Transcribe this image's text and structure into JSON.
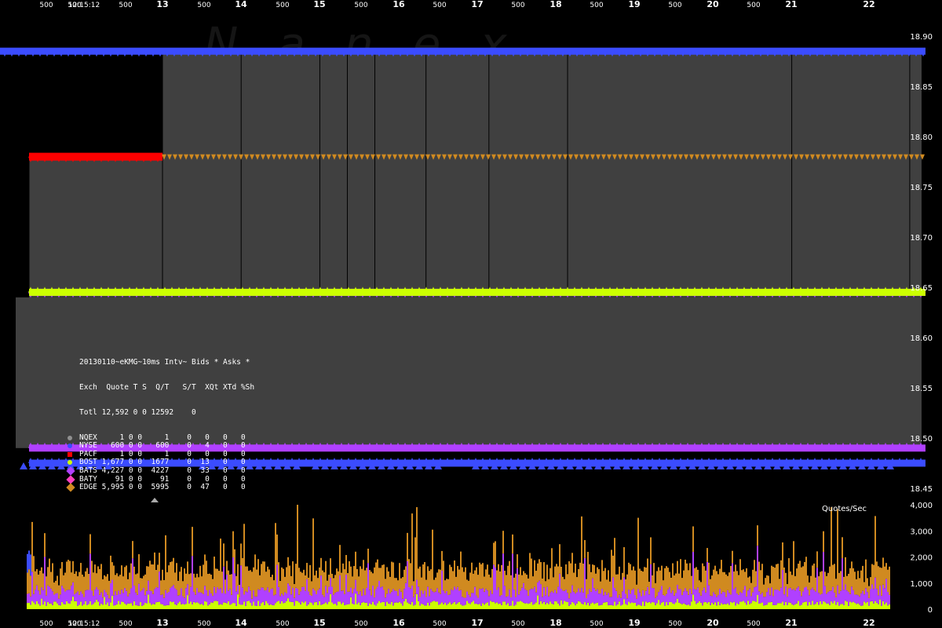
{
  "watermark": "Nanex",
  "x_axis": {
    "labels_top": [
      "500",
      "12:15:12",
      "500",
      "13",
      "500",
      "14",
      "500",
      "15",
      "500",
      "16",
      "500",
      "17",
      "500",
      "18",
      "500",
      "19",
      "500",
      "20",
      "500",
      "21",
      "500",
      "22"
    ],
    "labels_bottom": [
      "500",
      "12:15:12",
      "500",
      "13",
      "500",
      "14",
      "500",
      "15",
      "500",
      "16",
      "500",
      "17",
      "500",
      "18",
      "500",
      "19",
      "500",
      "20",
      "500",
      "21",
      "500",
      "22"
    ]
  },
  "price_axis": [
    "18.90",
    "18.85",
    "18.80",
    "18.75",
    "18.70",
    "18.65",
    "18.60",
    "18.55",
    "18.50",
    "18.45"
  ],
  "rate_axis": [
    "4,000",
    "3,000",
    "2,000",
    "1,000",
    "0"
  ],
  "rate_axis_title": "Quotes/Sec",
  "legend": {
    "title": "20130110~eKMG~10ms Intv~ Bids * Asks *",
    "header": "Exch  Quote T S  Q/T   S/T  XQt XTd %Sh",
    "total": "Totl 12,592 0 0 12592    0",
    "rows": [
      {
        "exch": "NQEX",
        "text": "NQEX     1 0 0     1    0   0   0   0",
        "color": "#909090",
        "shape": "circle"
      },
      {
        "exch": "NYSE",
        "text": "NYSE   600 0 0   600    0   4   0   0",
        "color": "#3b4cff",
        "shape": "circle"
      },
      {
        "exch": "PACF",
        "text": "PACF     1 0 0     1    0   0   0   0",
        "color": "#ff0000",
        "shape": "square"
      },
      {
        "exch": "BOST",
        "text": "BOST 1,677 0 0  1677    0  13   0   0",
        "color": "#ccff00",
        "shape": "circle"
      },
      {
        "exch": "BATS",
        "text": "BATS 4,227 0 0  4227    0  33   0   0",
        "color": "#b040ff",
        "shape": "diamond"
      },
      {
        "exch": "BATY",
        "text": "BATY    91 0 0    91    0   0   0   0",
        "color": "#ff40c0",
        "shape": "diamond"
      },
      {
        "exch": "EDGE",
        "text": "EDGE 5,995 0 0  5995    0  47   0   0",
        "color": "#d08a20",
        "shape": "diamond"
      }
    ]
  },
  "chart_data": [
    {
      "type": "line",
      "title": "20130110~eKMG~10ms Intv~ Bids * Asks *",
      "ylim": [
        18.45,
        18.9
      ],
      "x_start_label": "12:15:12",
      "series": [
        {
          "name": "NYSE",
          "role": "ask",
          "color": "#3b4cff",
          "x": [
            0,
            13.0,
            22.7
          ],
          "y": [
            18.88,
            18.885,
            18.885
          ]
        },
        {
          "name": "PACF",
          "role": "ask",
          "color": "#ff0000",
          "x": [
            12.0,
            13.0
          ],
          "y": [
            18.78,
            18.78
          ]
        },
        {
          "name": "EDGE",
          "role": "ask",
          "color": "#d08a20",
          "x": [
            13.0,
            22.7
          ],
          "y": [
            18.78,
            18.78
          ]
        },
        {
          "name": "BATS",
          "role": "bid",
          "color": "#b040ff",
          "x": [
            12.0,
            22.7
          ],
          "y": [
            18.645,
            18.645
          ]
        },
        {
          "name": "BOST",
          "role": "bid",
          "color": "#ccff00",
          "x": [
            12.0,
            22.7
          ],
          "y": [
            18.645,
            18.645
          ]
        },
        {
          "name": "BATS",
          "role": "bid",
          "color": "#b040ff",
          "x": [
            12.0,
            22.7
          ],
          "y": [
            18.49,
            18.49
          ]
        },
        {
          "name": "NYSE",
          "role": "bid",
          "color": "#3b4cff",
          "x": [
            12.0,
            22.7
          ],
          "y": [
            18.475,
            18.475
          ]
        }
      ],
      "spread_fills": [
        {
          "x_from": 12.0,
          "x_to": 13.0,
          "y_from": 18.64,
          "y_to": 18.78,
          "color": "#404040"
        },
        {
          "x_from": 13.0,
          "x_to": 22.65,
          "y_from": 18.64,
          "y_to": 18.885,
          "color": "#404040"
        },
        {
          "x_from": 11.9,
          "x_to": 22.65,
          "y_from": 18.49,
          "y_to": 18.64,
          "color": "#404040"
        }
      ],
      "trade_markers_x": [
        12.0,
        12.0,
        13.0,
        14.0,
        15.0,
        15.35,
        15.7,
        16.35,
        17.15,
        18.15,
        21.0,
        22.5
      ]
    },
    {
      "type": "bar",
      "title": "Quotes/Sec",
      "ylim": [
        0,
        4000
      ],
      "stacked_series": [
        {
          "name": "BOST",
          "color": "#ccff00",
          "typical": 250,
          "peak": 600
        },
        {
          "name": "BATS",
          "color": "#b040ff",
          "typical": 500,
          "peak": 1900
        },
        {
          "name": "EDGE",
          "color": "#d08a20",
          "typical": 900,
          "peak": 3300
        },
        {
          "name": "NYSE",
          "color": "#3b4cff",
          "x_range": [
            12.0,
            12.1
          ],
          "peak": 1600
        }
      ]
    }
  ]
}
